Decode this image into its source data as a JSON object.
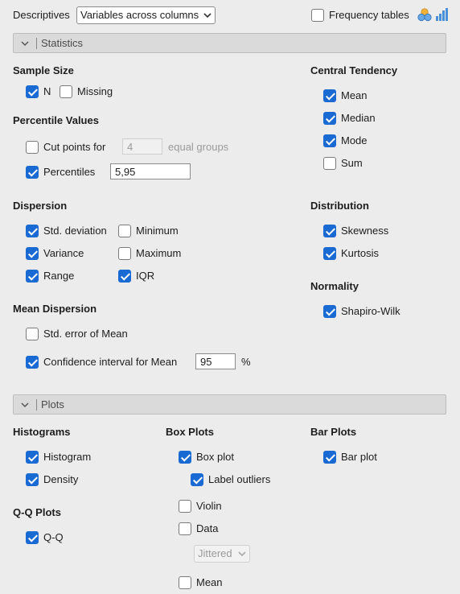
{
  "header": {
    "descriptives_label": "Descriptives",
    "layout_select_value": "Variables across columns",
    "frequency_tables_label": "Frequency tables",
    "frequency_tables_checked": false
  },
  "statistics_section": {
    "title": "Statistics",
    "sample_size": {
      "heading": "Sample Size",
      "n_label": "N",
      "n_checked": true,
      "missing_label": "Missing",
      "missing_checked": false
    },
    "percentile_values": {
      "heading": "Percentile Values",
      "cut_points_label": "Cut points for",
      "cut_points_checked": false,
      "cut_points_value": "4",
      "equal_groups_label": "equal groups",
      "percentiles_label": "Percentiles",
      "percentiles_checked": true,
      "percentiles_value": "5,95"
    },
    "dispersion": {
      "heading": "Dispersion",
      "std_deviation": "Std. deviation",
      "variance": "Variance",
      "range": "Range",
      "minimum": "Minimum",
      "maximum": "Maximum",
      "iqr": "IQR",
      "checked": {
        "std_deviation": true,
        "variance": true,
        "range": true,
        "minimum": false,
        "maximum": false,
        "iqr": true
      }
    },
    "mean_dispersion": {
      "heading": "Mean Dispersion",
      "se_mean_label": "Std. error of Mean",
      "se_mean_checked": false,
      "ci_mean_label": "Confidence interval for Mean",
      "ci_mean_checked": true,
      "ci_value": "95",
      "ci_unit": "%"
    },
    "central_tendency": {
      "heading": "Central Tendency",
      "mean": "Mean",
      "median": "Median",
      "mode": "Mode",
      "sum": "Sum",
      "checked": {
        "mean": true,
        "median": true,
        "mode": true,
        "sum": false
      }
    },
    "distribution": {
      "heading": "Distribution",
      "skewness": "Skewness",
      "kurtosis": "Kurtosis",
      "checked": {
        "skewness": true,
        "kurtosis": true
      }
    },
    "normality": {
      "heading": "Normality",
      "shapiro_wilk": "Shapiro-Wilk",
      "shapiro_wilk_checked": true
    }
  },
  "plots_section": {
    "title": "Plots",
    "histograms": {
      "heading": "Histograms",
      "histogram": "Histogram",
      "density": "Density",
      "checked": {
        "histogram": true,
        "density": true
      }
    },
    "qq_plots": {
      "heading": "Q-Q Plots",
      "qq": "Q-Q",
      "qq_checked": true
    },
    "box_plots": {
      "heading": "Box Plots",
      "box_plot": "Box plot",
      "label_outliers": "Label outliers",
      "violin": "Violin",
      "data": "Data",
      "mean": "Mean",
      "data_style_value": "Jittered",
      "checked": {
        "box_plot": true,
        "label_outliers": true,
        "violin": false,
        "data": false,
        "mean": false
      }
    },
    "bar_plots": {
      "heading": "Bar Plots",
      "bar_plot": "Bar plot",
      "bar_plot_checked": true
    }
  },
  "colors": {
    "accent": "#1a6ad3",
    "background": "#ececec",
    "section_header": "#dadada"
  },
  "icons": {
    "frequency_icons": [
      "venn-icon",
      "bar-chart-icon"
    ],
    "collapse": "chevron-down-icon"
  }
}
